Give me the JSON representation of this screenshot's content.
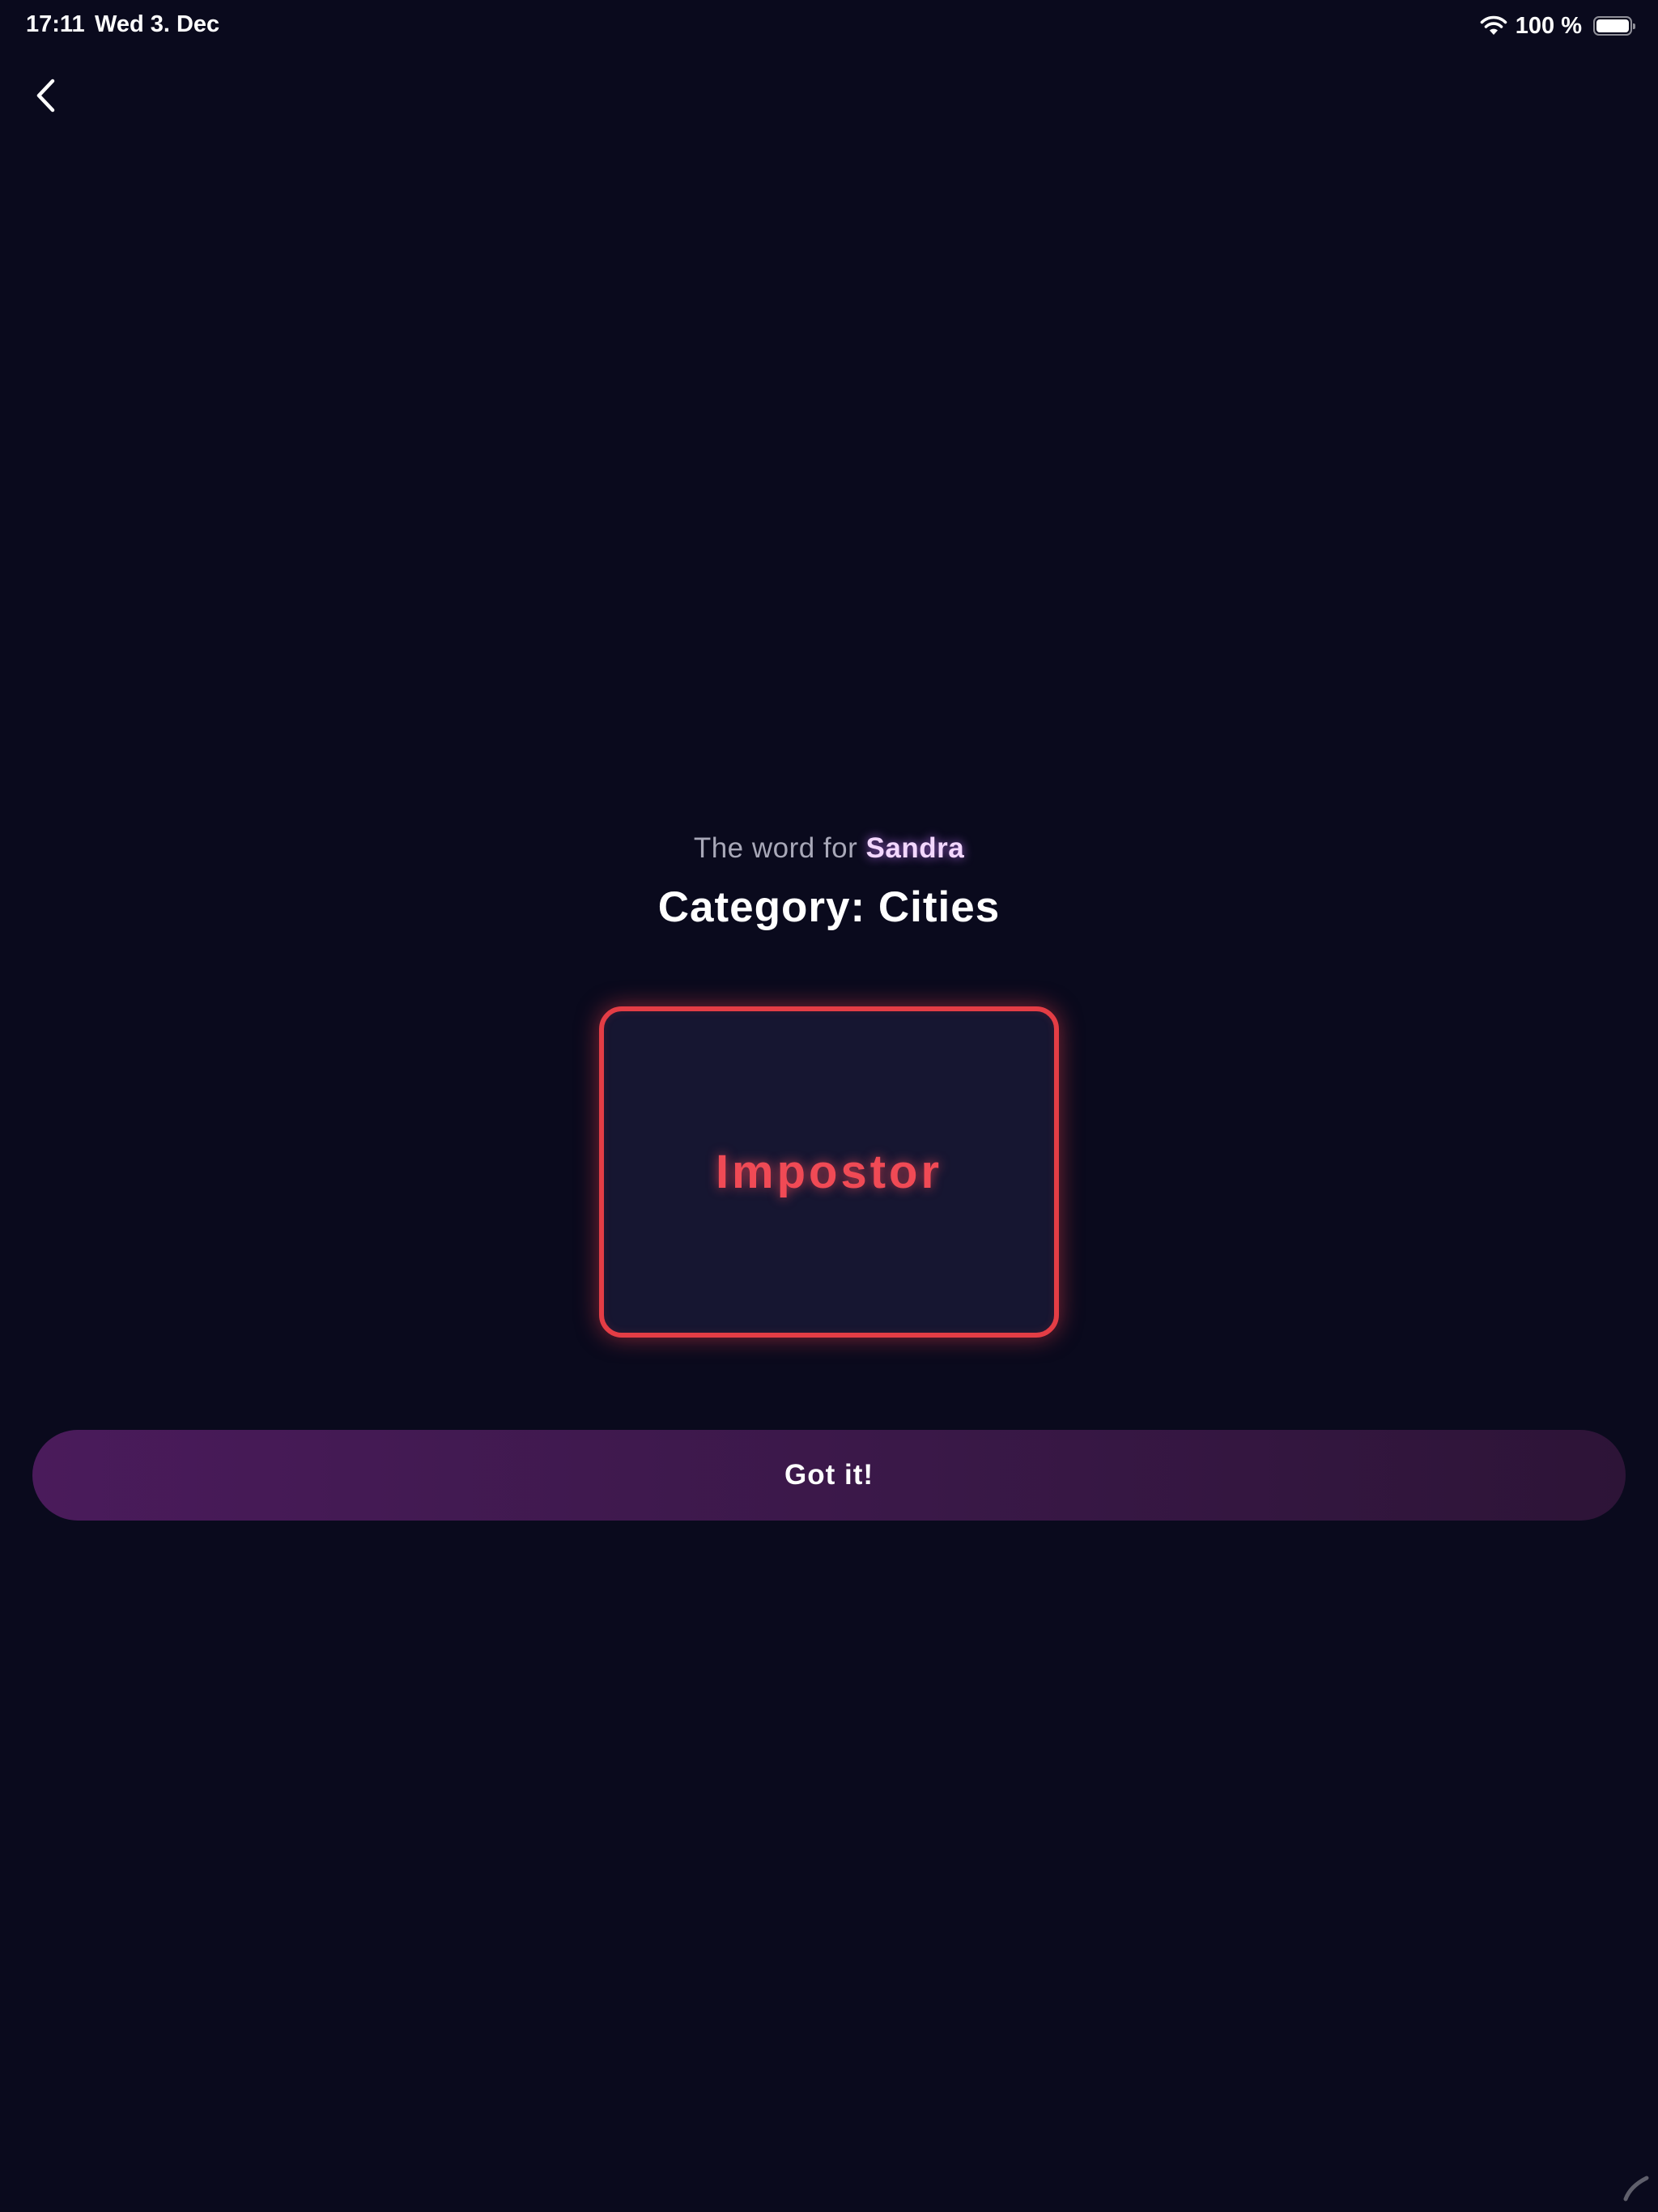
{
  "status_bar": {
    "time": "17:11",
    "date": "Wed 3. Dec",
    "battery_percent": "100 %",
    "wifi_icon": "wifi-icon",
    "battery_icon": "battery-full-icon"
  },
  "navigation": {
    "back_icon": "chevron-left-icon"
  },
  "main": {
    "word_for_prefix": "The word for",
    "player_name": "Sandra",
    "category": "Category: Cities",
    "role": "Impostor",
    "confirm_label": "Got it!"
  },
  "colors": {
    "background": "#0a0a1d",
    "card_border": "#e43d45",
    "role_text": "#f04a55",
    "button_gradient_start": "#4a1b5b",
    "button_gradient_end": "#2d1437",
    "player_name": "#f3d7ff"
  }
}
